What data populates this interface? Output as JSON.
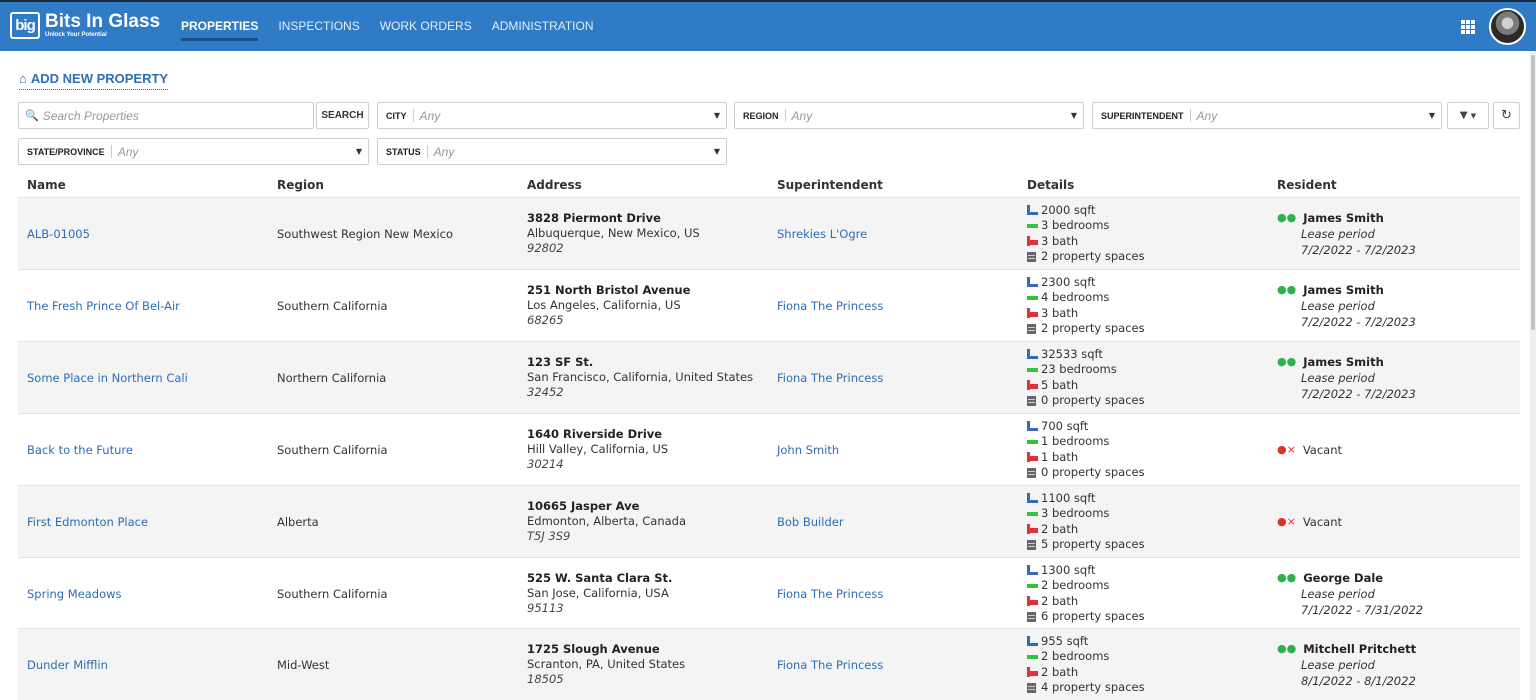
{
  "app": {
    "logo_mark": "big",
    "logo_name": "Bits In Glass",
    "logo_tagline": "Unlock Your Potential"
  },
  "nav": [
    {
      "label": "PROPERTIES",
      "active": true
    },
    {
      "label": "INSPECTIONS",
      "active": false
    },
    {
      "label": "WORK ORDERS",
      "active": false
    },
    {
      "label": "ADMINISTRATION",
      "active": false
    }
  ],
  "colors": {
    "header": "#2f7bc6",
    "link": "#2f6db4",
    "occupied": "#2bb24c",
    "vacant": "#d9342c"
  },
  "toolbar": {
    "add_label": "ADD NEW PROPERTY",
    "search_placeholder": "Search Properties",
    "search_button": "SEARCH",
    "filters": {
      "city": {
        "label": "CITY",
        "value": "Any"
      },
      "region": {
        "label": "REGION",
        "value": "Any"
      },
      "superintendent": {
        "label": "SUPERINTENDENT",
        "value": "Any"
      },
      "state": {
        "label": "STATE/PROVINCE",
        "value": "Any"
      },
      "status": {
        "label": "STATUS",
        "value": "Any"
      }
    }
  },
  "table": {
    "columns": {
      "name": "Name",
      "region": "Region",
      "address": "Address",
      "superintendent": "Superintendent",
      "details": "Details",
      "resident": "Resident"
    },
    "rows": [
      {
        "name": "ALB-01005",
        "region": "Southwest Region New Mexico",
        "street": "3828 Piermont Drive",
        "city": "Albuquerque, New Mexico, US",
        "zip": "92802",
        "superintendent": "Shrekies L'Ogre",
        "sqft": "2000 sqft",
        "bedrooms": "3 bedrooms",
        "bath": "3 bath",
        "spaces": "2 property spaces",
        "resident": "James Smith",
        "lease_label": "Lease period",
        "lease": "7/2/2022 - 7/2/2023"
      },
      {
        "name": "The Fresh Prince Of Bel-Air",
        "region": "Southern California",
        "street": "251 North Bristol Avenue",
        "city": "Los Angeles, California, US",
        "zip": "68265",
        "superintendent": "Fiona The Princess",
        "sqft": "2300 sqft",
        "bedrooms": "4 bedrooms",
        "bath": "3 bath",
        "spaces": "2 property spaces",
        "resident": "James Smith",
        "lease_label": "Lease period",
        "lease": "7/2/2022 - 7/2/2023"
      },
      {
        "name": "Some Place in Northern Cali",
        "region": "Northern California",
        "street": "123 SF St.",
        "city": "San Francisco, California, United States",
        "zip": "32452",
        "superintendent": "Fiona The Princess",
        "sqft": "32533 sqft",
        "bedrooms": "23 bedrooms",
        "bath": "5 bath",
        "spaces": "0 property spaces",
        "resident": "James Smith",
        "lease_label": "Lease period",
        "lease": "7/2/2022 - 7/2/2023"
      },
      {
        "name": "Back to the Future",
        "region": "Southern California",
        "street": "1640 Riverside Drive",
        "city": "Hill Valley, California, US",
        "zip": "30214",
        "superintendent": "John Smith",
        "sqft": "700 sqft",
        "bedrooms": "1 bedrooms",
        "bath": "1 bath",
        "spaces": "0 property spaces",
        "vacant": "Vacant"
      },
      {
        "name": "First Edmonton Place",
        "region": "Alberta",
        "street": "10665 Jasper Ave",
        "city": "Edmonton, Alberta, Canada",
        "zip": "T5J 3S9",
        "superintendent": "Bob Builder",
        "sqft": "1100 sqft",
        "bedrooms": "3 bedrooms",
        "bath": "2 bath",
        "spaces": "5 property spaces",
        "vacant": "Vacant"
      },
      {
        "name": "Spring Meadows",
        "region": "Southern California",
        "street": "525 W. Santa Clara St.",
        "city": "San Jose, California, USA",
        "zip": "95113",
        "superintendent": "Fiona The Princess",
        "sqft": "1300 sqft",
        "bedrooms": "2 bedrooms",
        "bath": "2 bath",
        "spaces": "6 property spaces",
        "resident": "George Dale",
        "lease_label": "Lease period",
        "lease": "7/1/2022 - 7/31/2022"
      },
      {
        "name": "Dunder Mifflin",
        "region": "Mid-West",
        "street": "1725 Slough Avenue",
        "city": "Scranton, PA, United States",
        "zip": "18505",
        "superintendent": "Fiona The Princess",
        "sqft": "955 sqft",
        "bedrooms": "2 bedrooms",
        "bath": "2 bath",
        "spaces": "4 property spaces",
        "resident": "Mitchell Pritchett",
        "lease_label": "Lease period",
        "lease": "8/1/2022 - 8/1/2022"
      }
    ]
  }
}
